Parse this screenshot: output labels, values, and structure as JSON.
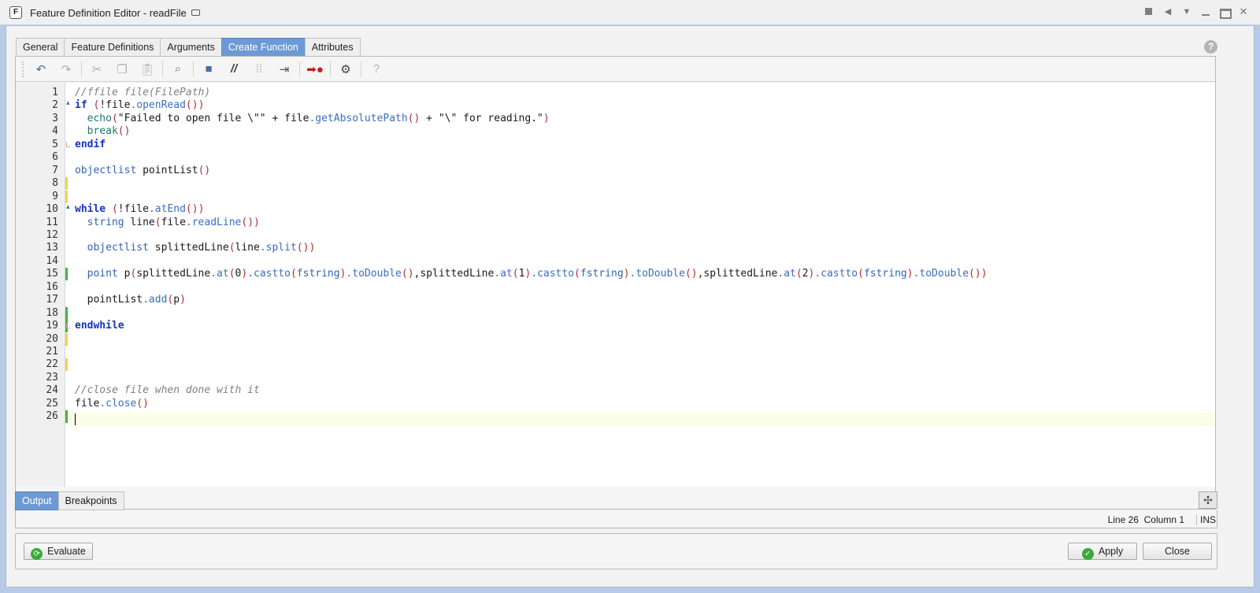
{
  "window": {
    "title": "Feature Definition Editor - readFile",
    "app_icon_letter": "F"
  },
  "tabs": [
    {
      "label": "General",
      "active": false
    },
    {
      "label": "Feature Definitions",
      "active": false
    },
    {
      "label": "Arguments",
      "active": false
    },
    {
      "label": "Create Function",
      "active": true
    },
    {
      "label": "Attributes",
      "active": false
    }
  ],
  "toolbar": {
    "icons": [
      "undo-icon",
      "redo-icon",
      "cut-icon",
      "copy-icon",
      "paste-icon",
      "find-icon",
      "folder-icon",
      "comment-icon",
      "uncomment-icon",
      "indent-icon",
      "breakpoint-icon",
      "settings-icon",
      "help-icon"
    ]
  },
  "editor": {
    "line_numbers": [
      "1",
      "2",
      "3",
      "4",
      "5",
      "6",
      "7",
      "8",
      "9",
      "10",
      "11",
      "12",
      "13",
      "14",
      "15",
      "16",
      "17",
      "18",
      "19",
      "20",
      "21",
      "22",
      "23",
      "24",
      "25",
      "26"
    ],
    "lines": [
      "//ffile file(FilePath)",
      "if (!file.openRead())",
      "  echo(\"Failed to open file \\\"\" + file.getAbsolutePath() + \"\\\" for reading.\")",
      "  break()",
      "endif",
      "",
      "objectlist pointList()",
      "",
      "",
      "while (!file.atEnd())",
      "  string line(file.readLine())",
      "",
      "  objectlist splittedLine(line.split())",
      "",
      "  point p(splittedLine.at(0).castto(fstring).toDouble(),splittedLine.at(1).castto(fstring).toDouble(),splittedLine.at(2).castto(fstring).toDouble())",
      "",
      "  pointList.add(p)",
      "",
      "endwhile",
      "",
      "",
      "",
      "",
      "//close file when done with it",
      "file.close()",
      ""
    ]
  },
  "bottom_tabs": [
    {
      "label": "Output",
      "active": true
    },
    {
      "label": "Breakpoints",
      "active": false
    }
  ],
  "status": {
    "line": "Line 26",
    "column": "Column 1",
    "mode": "INS"
  },
  "buttons": {
    "evaluate": "Evaluate",
    "apply": "Apply",
    "close": "Close"
  },
  "colors": {
    "active_tab": "#6d9ad4",
    "keyword": "#1732c7",
    "method": "#3a6ec2",
    "comment": "#808080"
  }
}
